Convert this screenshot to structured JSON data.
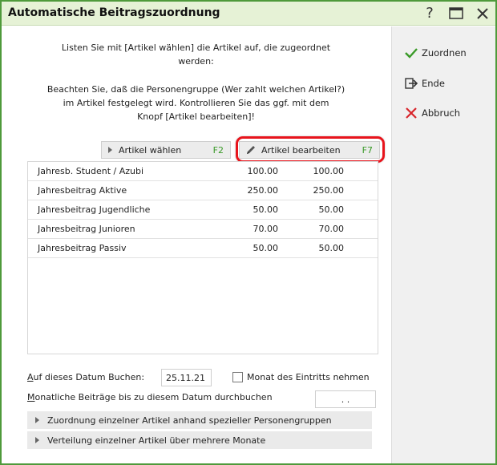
{
  "window": {
    "title": "Automatische Beitragszuordnung",
    "help_icon": "?",
    "maximize_icon": "maximize-icon",
    "close_icon": "close-icon"
  },
  "sidebar": {
    "assign_label": "Zuordnen",
    "end_label": "Ende",
    "cancel_label": "Abbruch"
  },
  "info": {
    "line1": "Listen Sie mit [Artikel wählen] die Artikel auf, die zugeordnet",
    "line2": "werden:",
    "line3": "Beachten Sie, daß die Personengruppe (Wer zahlt welchen Artikel?)",
    "line4": "im Artikel festgelegt wird. Kontrollieren Sie das ggf. mit dem",
    "line5": "Knopf [Artikel bearbeiten]!"
  },
  "toolbar": {
    "select_label": "Artikel wählen",
    "select_key": "F2",
    "edit_label": "Artikel bearbeiten",
    "edit_key": "F7"
  },
  "table": {
    "rows": [
      {
        "name": "Jahresb. Student / Azubi",
        "v1": "100.00",
        "v2": "100.00"
      },
      {
        "name": "Jahresbeitrag Aktive",
        "v1": "250.00",
        "v2": "250.00"
      },
      {
        "name": "Jahresbeitrag Jugendliche",
        "v1": "50.00",
        "v2": "50.00"
      },
      {
        "name": "Jahresbeitrag Junioren",
        "v1": "70.00",
        "v2": "70.00"
      },
      {
        "name": "Jahresbeitrag Passiv",
        "v1": "50.00",
        "v2": "50.00"
      }
    ]
  },
  "form": {
    "date_label_first": "A",
    "date_label_rest": "uf dieses Datum Buchen:",
    "date_value": "25.11.21",
    "entry_month_label": "Monat des Eintritts nehmen",
    "monthly_label_first": "M",
    "monthly_label_rest": "onatliche Beiträge bis zu diesem Datum durchbuchen",
    "monthly_date_value": ". ."
  },
  "expanders": {
    "group_assign": "Zuordnung einzelner Artikel anhand spezieller Personengruppen",
    "month_spread": "Verteilung einzelner Artikel über mehrere Monate"
  }
}
